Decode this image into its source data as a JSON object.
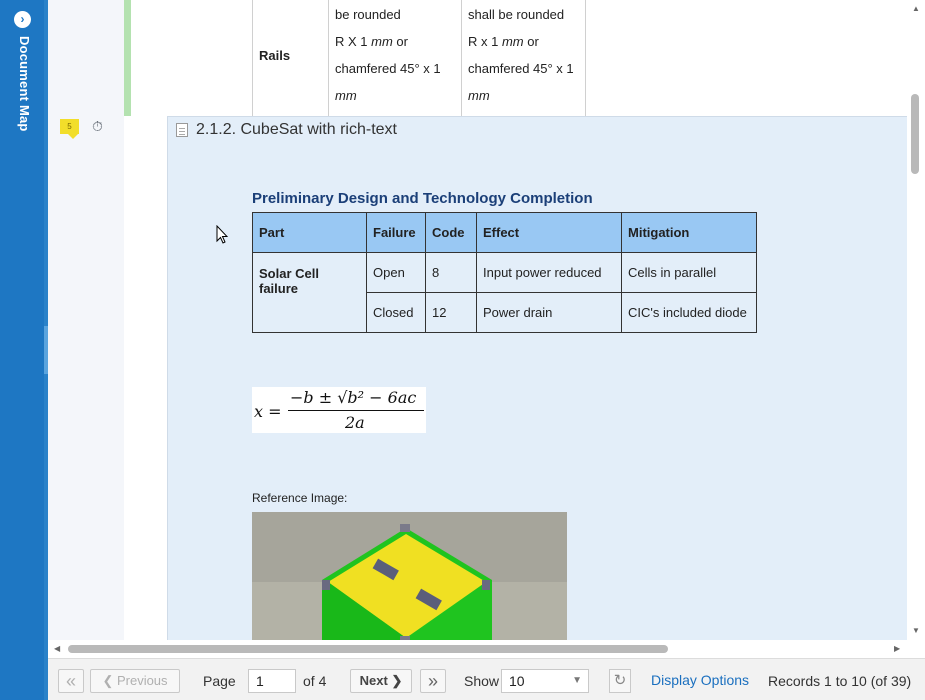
{
  "document_map": {
    "label": "Document Map",
    "toggle_icon": "chevron-right-icon"
  },
  "gutter": {
    "comment_count": "5",
    "timer_icon": "stopwatch-icon"
  },
  "top_table": {
    "row_label": "Rails",
    "cell_2": [
      "be rounded",
      "R X 1 ",
      "mm",
      " or",
      "chamfered 45° x 1",
      "mm"
    ],
    "cell_3": [
      "shall be rounded",
      "R x 1 ",
      "mm",
      " or",
      "chamfered 45° x 1",
      "mm"
    ]
  },
  "section": {
    "title": "2.1.2. CubeSat with rich-text",
    "subtitle": "Preliminary Design and Technology Completion",
    "table": {
      "headers": [
        "Part",
        "Failure",
        "Code",
        "Effect",
        "Mitigation"
      ],
      "part": "Solar Cell failure",
      "rows": [
        {
          "failure": "Open",
          "code": "8",
          "effect": "Input power reduced",
          "mitigation": "Cells in parallel"
        },
        {
          "failure": "Closed",
          "code": "12",
          "effect": "Power drain",
          "mitigation": "CIC's included diode"
        }
      ]
    },
    "equation": {
      "lhs": "x =",
      "numerator": "−b ± √b² − 6ac",
      "denominator": "2a"
    },
    "reference_label": "Reference Image:"
  },
  "pager": {
    "first_icon": "double-chevron-left-icon",
    "previous_label": "❮  Previous",
    "page_label": "Page",
    "page_value": "1",
    "of_label": "of 4",
    "next_label": "Next ❯",
    "last_icon": "double-chevron-right-icon",
    "show_label": "Show",
    "show_value": "10",
    "refresh_icon": "refresh-icon",
    "options_label": "Display Options",
    "records_label": "Records 1 to 10 (of 39)"
  },
  "colors": {
    "sidebar_blue": "#1e77c3",
    "section_bg": "#e3eef9",
    "table_header": "#99c8f3",
    "title_blue": "#1b3f78",
    "link_blue": "#1a6fbf"
  }
}
